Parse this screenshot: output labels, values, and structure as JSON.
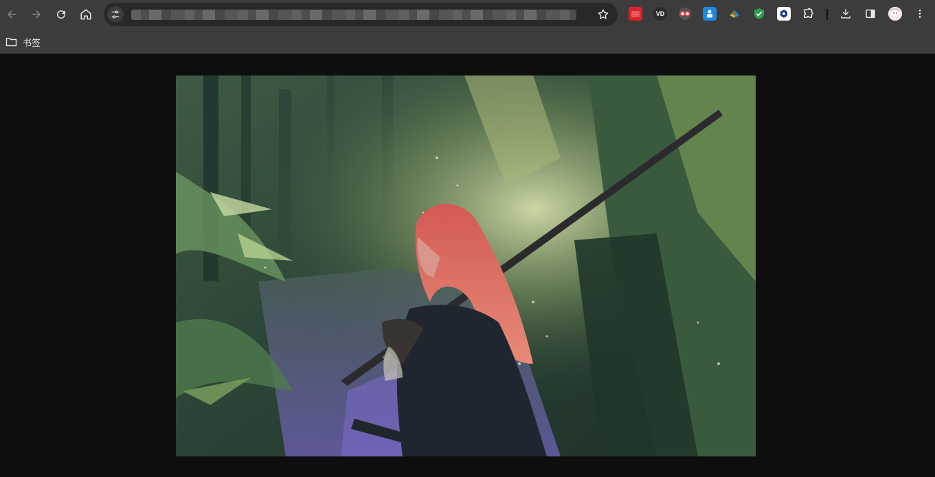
{
  "browser": {
    "toolbar": {
      "back_icon": "arrow-left-icon",
      "forward_icon": "arrow-right-icon",
      "reload_icon": "reload-icon",
      "home_icon": "home-icon"
    },
    "omnibox": {
      "url": "",
      "site_info_icon": "tune-icon",
      "bookmark_icon": "star-icon"
    },
    "extensions": [
      {
        "icon": "red-extension-icon",
        "color": "#e0202a"
      },
      {
        "icon": "vd-extension-icon",
        "label": "VD",
        "color": "#444444"
      },
      {
        "icon": "glasses-extension-icon",
        "color": "#555555"
      },
      {
        "icon": "blue-extension-icon",
        "color": "#1e88e5"
      },
      {
        "icon": "colorful-extension-icon",
        "color": "#43a047"
      },
      {
        "icon": "shield-extension-icon",
        "color": "#2e9e4f"
      },
      {
        "icon": "hex-extension-icon",
        "color": "#ffffff"
      },
      {
        "icon": "puzzle-icon"
      }
    ],
    "download_icon": "download-icon",
    "sidepanel_icon": "side-panel-icon",
    "profile_icon": "avatar",
    "menu_icon": "kebab-menu-icon"
  },
  "bookmarks_bar": {
    "folder_icon": "folder-icon",
    "folder_label": "书签"
  },
  "content": {
    "image_description_icon": "artwork-image",
    "background_color": "#0e0e0e"
  }
}
